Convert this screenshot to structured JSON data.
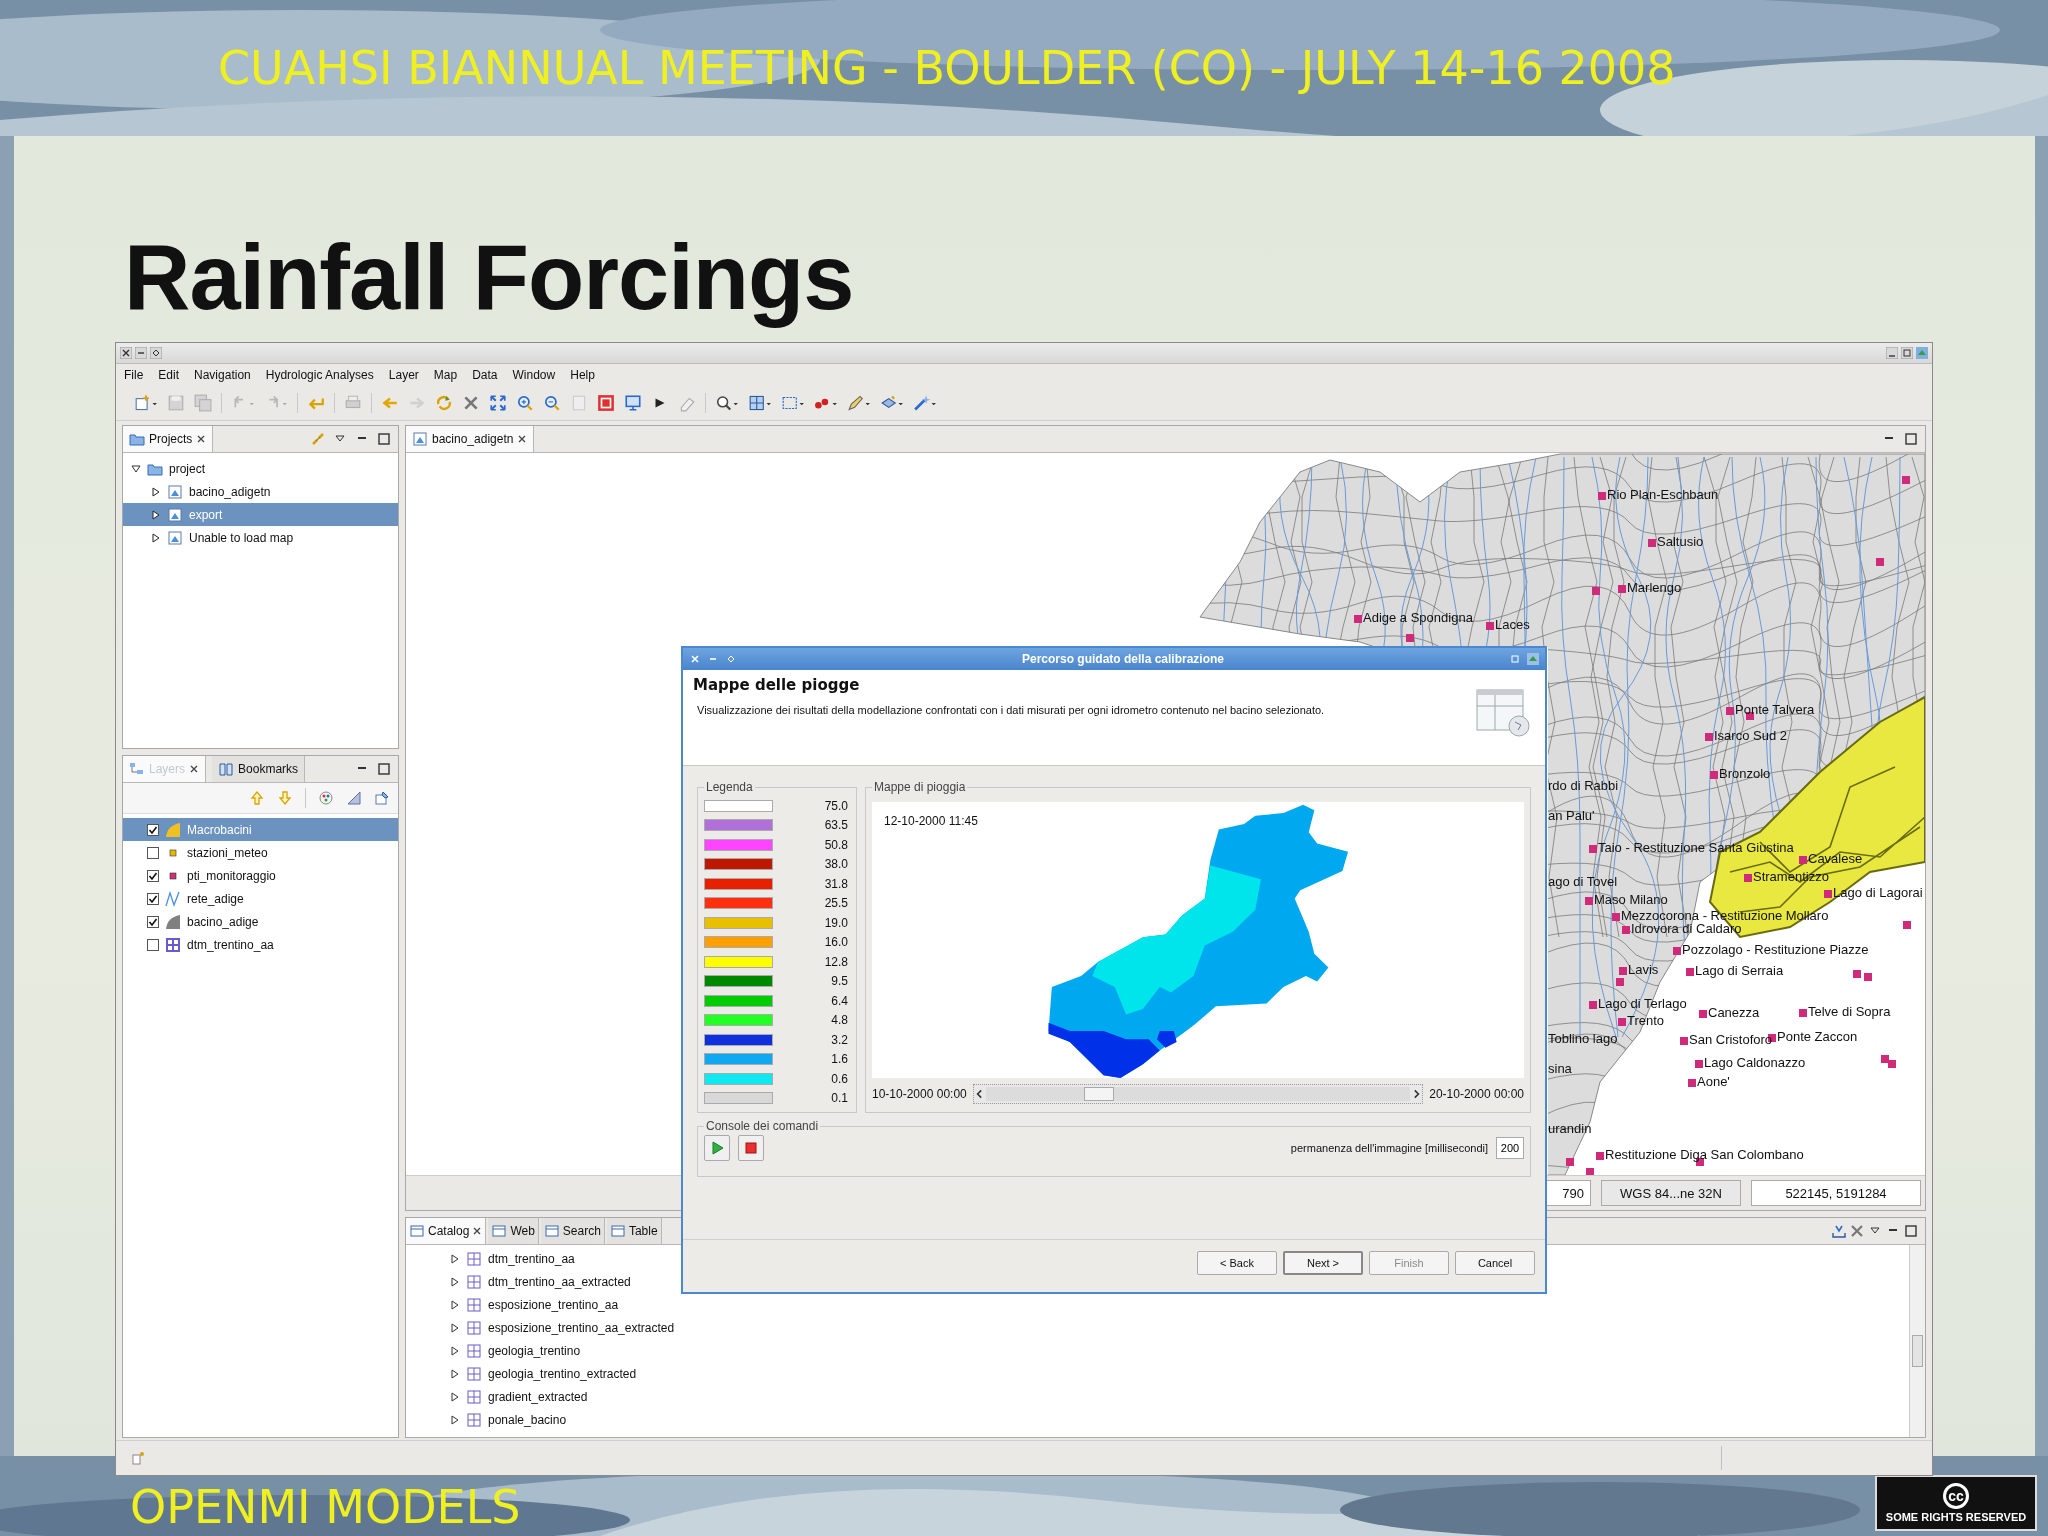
{
  "slide": {
    "header": "CUAHSI BIANNUAL MEETING - BOULDER (CO) - JULY 14-16 2008",
    "title": "Rainfall Forcings",
    "footer": "OPENMI MODELS",
    "license_badge": {
      "symbol": "cc",
      "text": "SOME RIGHTS RESERVED"
    }
  },
  "window": {
    "menu": [
      "File",
      "Edit",
      "Navigation",
      "Hydrologic Analyses",
      "Layer",
      "Map",
      "Data",
      "Window",
      "Help"
    ]
  },
  "projects_panel": {
    "tab": "Projects",
    "tree": [
      {
        "label": "project",
        "expanded": true,
        "selected": false,
        "children": [
          {
            "label": "bacino_adigetn",
            "expanded": false,
            "selected": false
          },
          {
            "label": "export",
            "expanded": false,
            "selected": true
          },
          {
            "label": "Unable to load map",
            "expanded": false,
            "selected": false
          }
        ]
      }
    ]
  },
  "layers_panel": {
    "tabs": [
      {
        "label": "Layers",
        "selected": true
      },
      {
        "label": "Bookmarks",
        "selected": false
      }
    ],
    "layers": [
      {
        "name": "Macrobacini",
        "kind": "polygon",
        "color": "#f0c020",
        "checked": true,
        "selected": true
      },
      {
        "name": "stazioni_meteo",
        "kind": "point",
        "color": "#e8b800",
        "checked": false,
        "selected": false
      },
      {
        "name": "pti_monitoraggio",
        "kind": "point",
        "color": "#d0307a",
        "checked": true,
        "selected": false
      },
      {
        "name": "rete_adige",
        "kind": "line",
        "color": "#4a90e0",
        "checked": true,
        "selected": false
      },
      {
        "name": "bacino_adige",
        "kind": "polygon",
        "color": "#808080",
        "checked": true,
        "selected": false
      },
      {
        "name": "dtm_trentino_aa",
        "kind": "raster",
        "color": "#6a5acd",
        "checked": false,
        "selected": false
      }
    ]
  },
  "editor": {
    "tab": "bacino_adigetn",
    "map_labels": [
      "Rio Plan-Eschbaun",
      "Saltusio",
      "Marlengo",
      "Adige a Spondigna",
      "Laces",
      "Ponte Talvera",
      "Isarco Sud 2",
      "Bronzolo",
      "rdo di Rabbi",
      "an Palu'",
      "Taio - Restituzione Santa Giustina",
      "Cavalese",
      "Stramentizzo",
      "ago di Tovel",
      "Lago di Lagorai",
      "Maso Milano",
      "Mezzocorona - Restituzione Mollaro",
      "Idrovora di Caldaro",
      "Pozzolago - Restituzione Piazze",
      "Lavis",
      "Lago di Serraia",
      "Lago di Terlago",
      "Trento",
      "Canezza",
      "Telve di Sopra",
      "Toblino lago",
      "San Cristoforo",
      "Ponte Zaccon",
      "sina",
      "Lago Caldonazzo",
      "Aone'",
      "urandin",
      "Restituzione Diga San Colombano"
    ],
    "status": [
      "790",
      "WGS 84...ne 32N",
      "522145, 5191284"
    ]
  },
  "catalog_panel": {
    "tabs": [
      {
        "label": "Catalog",
        "selected": true
      },
      {
        "label": "Web",
        "selected": false
      },
      {
        "label": "Search",
        "selected": false
      },
      {
        "label": "Table",
        "selected": false
      }
    ],
    "items": [
      {
        "label": "dtm_trentino_aa",
        "expanded": false
      },
      {
        "label": "dtm_trentino_aa_extracted",
        "expanded": false
      },
      {
        "label": "esposizione_trentino_aa",
        "expanded": false
      },
      {
        "label": "esposizione_trentino_aa_extracted",
        "expanded": false
      },
      {
        "label": "geologia_trentino",
        "expanded": false
      },
      {
        "label": "geologia_trentino_extracted",
        "expanded": false
      },
      {
        "label": "gradient_extracted",
        "expanded": false
      },
      {
        "label": "ponale_bacino",
        "expanded": false
      }
    ]
  },
  "dialog": {
    "title": "Percorso guidato della calibrazione",
    "heading": "Mappe delle piogge",
    "description": "Visualizzazione dei risultati della modellazione confrontati con i dati misurati per ogni idrometro contenuto nel bacino selezionato.",
    "legend_title": "Legenda",
    "legend": [
      {
        "value": "75.0",
        "color": "#ffffff"
      },
      {
        "value": "63.5",
        "color": "#b070d8"
      },
      {
        "value": "50.8",
        "color": "#ff44ff"
      },
      {
        "value": "38.0",
        "color": "#c01800"
      },
      {
        "value": "31.8",
        "color": "#e82000"
      },
      {
        "value": "25.5",
        "color": "#ff3010"
      },
      {
        "value": "19.0",
        "color": "#e8c000"
      },
      {
        "value": "16.0",
        "color": "#ffa000"
      },
      {
        "value": "12.8",
        "color": "#ffff00"
      },
      {
        "value": "9.5",
        "color": "#008800"
      },
      {
        "value": "6.4",
        "color": "#00cc00"
      },
      {
        "value": "4.8",
        "color": "#22ff22"
      },
      {
        "value": "3.2",
        "color": "#1030e0"
      },
      {
        "value": "1.6",
        "color": "#10a8f0"
      },
      {
        "value": "0.6",
        "color": "#10e8f0"
      },
      {
        "value": "0.1",
        "color": "#d8d8d8"
      }
    ],
    "map_title": "Mappe di pioggia",
    "timestamp": "12-10-2000 11:45",
    "range_start": "10-10-2000 00:00",
    "range_end": "20-10-2000 00:00",
    "time_slider": {
      "level": 0.25
    },
    "console_title": "Console dei comandi",
    "duration_label": "permanenza dell'immagine [millisecondi]",
    "duration_value": "200",
    "buttons": [
      {
        "label": "< Back",
        "disabled": false,
        "default": false
      },
      {
        "label": "Next >",
        "disabled": false,
        "default": true
      },
      {
        "label": "Finish",
        "disabled": true,
        "default": false
      },
      {
        "label": "Cancel",
        "disabled": false,
        "default": false
      }
    ]
  }
}
